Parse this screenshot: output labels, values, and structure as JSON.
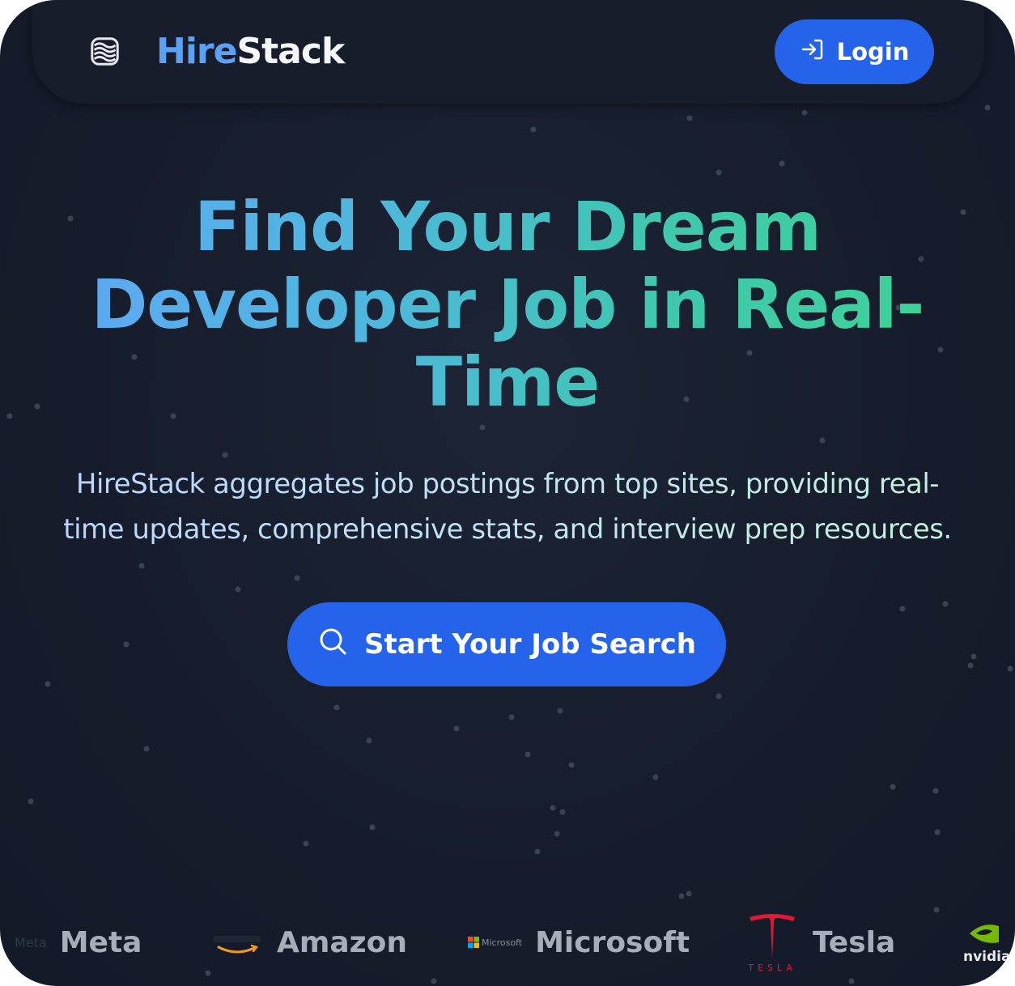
{
  "brand": {
    "part1": "Hire",
    "part2": "Stack"
  },
  "nav": {
    "login_label": "Login"
  },
  "hero": {
    "title_lines": [
      "Find Your Dream",
      "Developer Job in Real-",
      "Time"
    ],
    "subtitle_lines": [
      "HireStack aggregates job postings from top sites, providing real-",
      "time updates, comprehensive stats, and interview prep resources."
    ],
    "cta_label": "Start Your Job Search"
  },
  "companies": [
    {
      "logo_text": "Meta",
      "name": "Meta"
    },
    {
      "logo_text": "",
      "name": "Amazon"
    },
    {
      "logo_text": "Microsoft",
      "name": "Microsoft"
    },
    {
      "logo_text": "TESLA",
      "name": "Tesla"
    },
    {
      "logo_text": "nvidia",
      "name": ""
    }
  ],
  "colors": {
    "background": "#161c2b",
    "accent": "#2563eb",
    "brand_blue": "#5aa2f6",
    "gradient_start": "#5ea7f5",
    "gradient_end": "#3ed493",
    "company_text": "#a7adb9"
  },
  "icons": {
    "logo": "layered-waves-logo-icon",
    "login": "login-arrow-icon",
    "search": "search-icon"
  }
}
